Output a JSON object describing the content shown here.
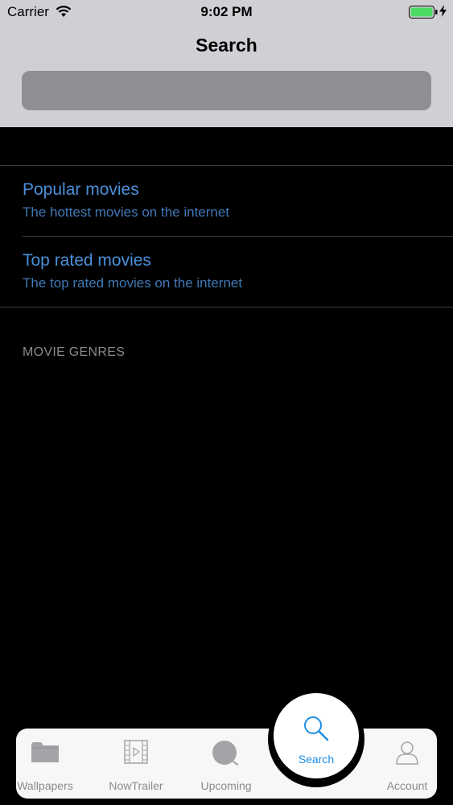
{
  "status_bar": {
    "carrier": "Carrier",
    "time": "9:02 PM",
    "wifi_icon": "wifi-icon",
    "battery_icon": "battery-charging-icon"
  },
  "header": {
    "title": "Search",
    "search_placeholder": ""
  },
  "lists": [
    {
      "title": "Popular movies",
      "subtitle": "The hottest movies on the internet"
    },
    {
      "title": "Top rated movies",
      "subtitle": "The top rated movies on the internet"
    }
  ],
  "genres_header": "MOVIE GENRES",
  "tab_bar": {
    "tabs": [
      {
        "label": "Wallpapers",
        "icon": "folder-icon"
      },
      {
        "label": "NowTrailer",
        "icon": "film-icon"
      },
      {
        "label": "Upcoming",
        "icon": "upcoming-icon"
      },
      {
        "label": "Search",
        "icon": "search-icon",
        "selected": true
      },
      {
        "label": "Account",
        "icon": "user-icon"
      }
    ]
  },
  "colors": {
    "header_bg": "#d0cfd4",
    "background": "#000000",
    "link": "#4a90d9",
    "active_tab": "#1d8ee3",
    "inactive_tab": "#8a8a8e"
  }
}
